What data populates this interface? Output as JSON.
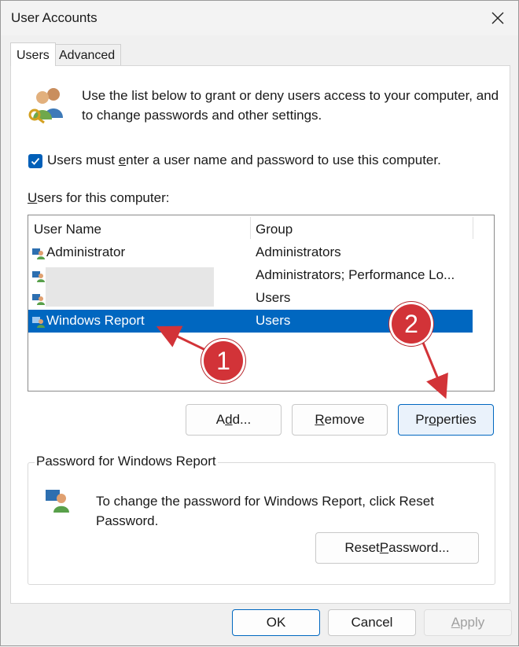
{
  "window": {
    "title": "User Accounts"
  },
  "tabs": [
    {
      "label": "Users",
      "active": true
    },
    {
      "label": "Advanced",
      "active": false
    }
  ],
  "intro_text": "Use the list below to grant or deny users access to your computer, and to change passwords and other settings.",
  "require_login": {
    "checked": true,
    "label_pre": "Users must ",
    "label_key": "e",
    "label_post": "nter a user name and password to use this computer."
  },
  "users_label": {
    "key": "U",
    "rest": "sers for this computer:"
  },
  "table": {
    "columns": [
      "User Name",
      "Group"
    ],
    "rows": [
      {
        "name": "Administrator",
        "group": "Administrators",
        "selected": false
      },
      {
        "name": "",
        "group": "Administrators; Performance Lo...",
        "selected": false
      },
      {
        "name": "",
        "group": "Users",
        "selected": false
      },
      {
        "name": "Windows Report",
        "group": "Users",
        "selected": true
      }
    ]
  },
  "buttons": {
    "add": {
      "pre": "A",
      "key": "d",
      "post": "d..."
    },
    "remove": {
      "pre": "",
      "key": "R",
      "post": "emove"
    },
    "properties": {
      "pre": "Pr",
      "key": "o",
      "post": "perties"
    },
    "reset": {
      "pre": "Reset ",
      "key": "P",
      "post": "assword..."
    },
    "ok": "OK",
    "cancel": "Cancel",
    "apply": {
      "key": "A",
      "post": "pply"
    }
  },
  "password_group": {
    "title": "Password for Windows Report",
    "text": "To change the password for Windows Report, click Reset Password."
  },
  "annotations": [
    "1",
    "2"
  ],
  "colors": {
    "accent": "#0067c0",
    "annotation": "#d23338"
  }
}
